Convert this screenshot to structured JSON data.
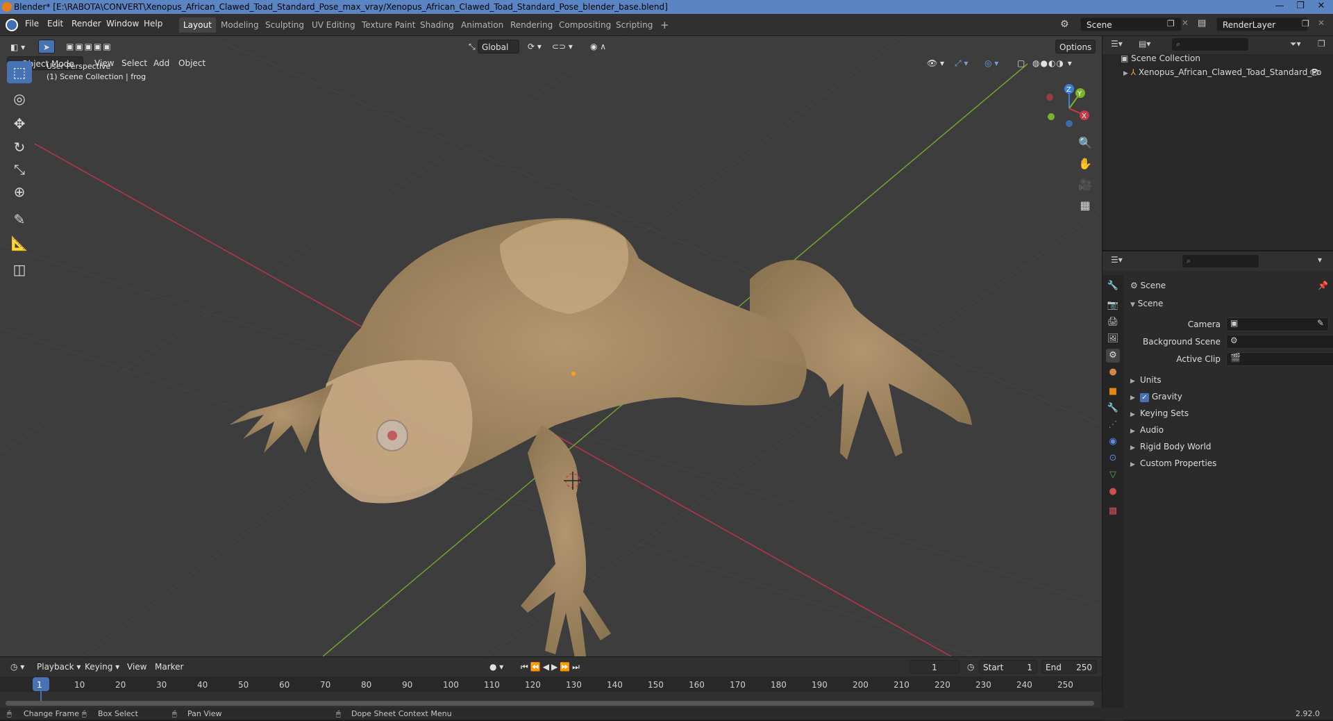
{
  "window": {
    "title": "Blender* [E:\\RABOTA\\CONVERT\\Xenopus_African_Clawed_Toad_Standard_Pose_max_vray/Xenopus_African_Clawed_Toad_Standard_Pose_blender_base.blend]",
    "min": "—",
    "max": "❐",
    "close": "✕"
  },
  "menubar": {
    "items": [
      "File",
      "Edit",
      "Render",
      "Window",
      "Help"
    ],
    "workspaces": [
      "Layout",
      "Modeling",
      "Sculpting",
      "UV Editing",
      "Texture Paint",
      "Shading",
      "Animation",
      "Rendering",
      "Compositing",
      "Scripting"
    ],
    "add_tab": "+",
    "scene": "Scene",
    "render_layer": "RenderLayer"
  },
  "viewport": {
    "mode": "Object Mode",
    "menus": [
      "View",
      "Select",
      "Add",
      "Object"
    ],
    "transform_orientation": "Global",
    "options": "Options",
    "overlay_line1": "User Perspective",
    "overlay_line2": "(1) Scene Collection | frog",
    "gizmo": {
      "z": "Z",
      "y": "Y",
      "x": "X"
    }
  },
  "outliner": {
    "root": "Scene Collection",
    "items": [
      "Xenopus_African_Clawed_Toad_Standard_Po"
    ]
  },
  "properties": {
    "context": "Scene",
    "panel": "Scene",
    "fields": [
      {
        "label": "Camera"
      },
      {
        "label": "Background Scene"
      },
      {
        "label": "Active Clip"
      }
    ],
    "collapsed_panels": [
      "Units",
      "Gravity",
      "Keying Sets",
      "Audio",
      "Rigid Body World",
      "Custom Properties"
    ],
    "gravity_checked": true
  },
  "timeline": {
    "menus": [
      "Playback",
      "Keying",
      "View",
      "Marker"
    ],
    "current_frame": "1",
    "start_label": "Start",
    "start": "1",
    "end_label": "End",
    "end": "250",
    "ruler": [
      "1",
      "10",
      "20",
      "30",
      "40",
      "50",
      "60",
      "70",
      "80",
      "90",
      "100",
      "110",
      "120",
      "130",
      "140",
      "150",
      "160",
      "170",
      "180",
      "190",
      "200",
      "210",
      "220",
      "230",
      "240",
      "250"
    ]
  },
  "statusbar": {
    "items": [
      "Change Frame",
      "Box Select",
      "Pan View",
      "Dope Sheet Context Menu"
    ],
    "version": "2.92.0"
  },
  "colors": {
    "accent": "#4772b3",
    "x_axis": "#c8394a",
    "y_axis": "#7ab32e",
    "z_axis": "#3b7fd8"
  }
}
